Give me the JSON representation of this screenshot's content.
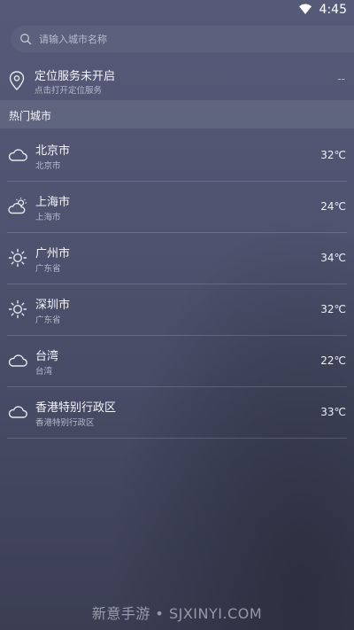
{
  "status_bar": {
    "time": "4:45",
    "wifi_icon": "wifi-icon"
  },
  "search": {
    "placeholder": "请输入城市名称",
    "icon": "search-icon"
  },
  "location": {
    "title": "定位服务未开启",
    "subtitle": "点击打开定位服务",
    "value": "--",
    "icon": "location-pin-icon"
  },
  "section_title": "热门城市",
  "cities": [
    {
      "name": "北京市",
      "province": "北京市",
      "temp": "32℃",
      "icon": "cloud-icon"
    },
    {
      "name": "上海市",
      "province": "上海市",
      "temp": "24℃",
      "icon": "partly-cloudy-icon"
    },
    {
      "name": "广州市",
      "province": "广东省",
      "temp": "34℃",
      "icon": "sun-icon"
    },
    {
      "name": "深圳市",
      "province": "广东省",
      "temp": "32℃",
      "icon": "sun-icon"
    },
    {
      "name": "台湾",
      "province": "台湾",
      "temp": "22℃",
      "icon": "cloud-icon"
    },
    {
      "name": "香港特别行政区",
      "province": "香港特别行政区",
      "temp": "33℃",
      "icon": "cloud-icon"
    }
  ],
  "watermark": "新意手游 • SJXINYI.COM"
}
